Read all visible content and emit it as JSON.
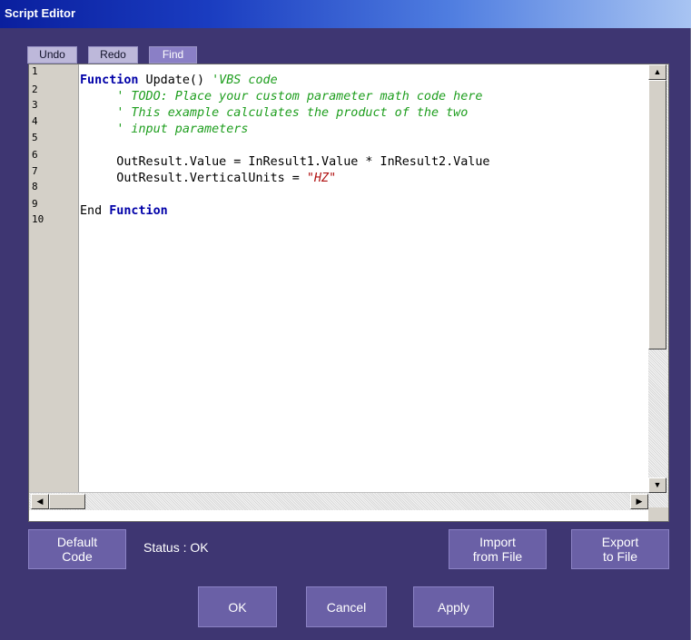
{
  "window": {
    "title": "Script Editor"
  },
  "toolbar": {
    "undo_label": "Undo",
    "redo_label": "Redo",
    "find_label": "Find"
  },
  "editor": {
    "line_numbers": [
      "1",
      "2",
      "3",
      "4",
      "5",
      "6",
      "7",
      "8",
      "9",
      "10"
    ],
    "lines": [
      {
        "segments": [
          {
            "t": "kw",
            "v": "Function"
          },
          {
            "t": "plain",
            "v": " Update() "
          },
          {
            "t": "cm",
            "v": "'VBS code"
          }
        ]
      },
      {
        "segments": [
          {
            "t": "plain",
            "v": "     "
          },
          {
            "t": "cm",
            "v": "' TODO: Place your custom parameter math code here"
          }
        ]
      },
      {
        "segments": [
          {
            "t": "plain",
            "v": "     "
          },
          {
            "t": "cm",
            "v": "' This example calculates the product of the two"
          }
        ]
      },
      {
        "segments": [
          {
            "t": "plain",
            "v": "     "
          },
          {
            "t": "cm",
            "v": "' input parameters"
          }
        ]
      },
      {
        "segments": []
      },
      {
        "segments": [
          {
            "t": "plain",
            "v": "     OutResult.Value = InResult1.Value * InResult2.Value"
          }
        ]
      },
      {
        "segments": [
          {
            "t": "plain",
            "v": "     OutResult.VerticalUnits = "
          },
          {
            "t": "str",
            "v": "\"HZ\""
          }
        ]
      },
      {
        "segments": []
      },
      {
        "segments": [
          {
            "t": "plain",
            "v": "End "
          },
          {
            "t": "kw",
            "v": "Function"
          }
        ]
      },
      {
        "segments": []
      }
    ],
    "scroll_up_glyph": "▲",
    "scroll_down_glyph": "▼",
    "scroll_left_glyph": "◀",
    "scroll_right_glyph": "▶"
  },
  "footer": {
    "default_code_line1": "Default",
    "default_code_line2": "Code",
    "status_text": "Status : OK",
    "import_line1": "Import",
    "import_line2": "from File",
    "export_line1": "Export",
    "export_line2": "to File",
    "ok_label": "OK",
    "cancel_label": "Cancel",
    "apply_label": "Apply"
  },
  "colors": {
    "window_bg": "#3e3672",
    "button_bg": "#6a60a6",
    "keyword": "#0000a8",
    "comment": "#1e9e1e",
    "string": "#b01010"
  }
}
